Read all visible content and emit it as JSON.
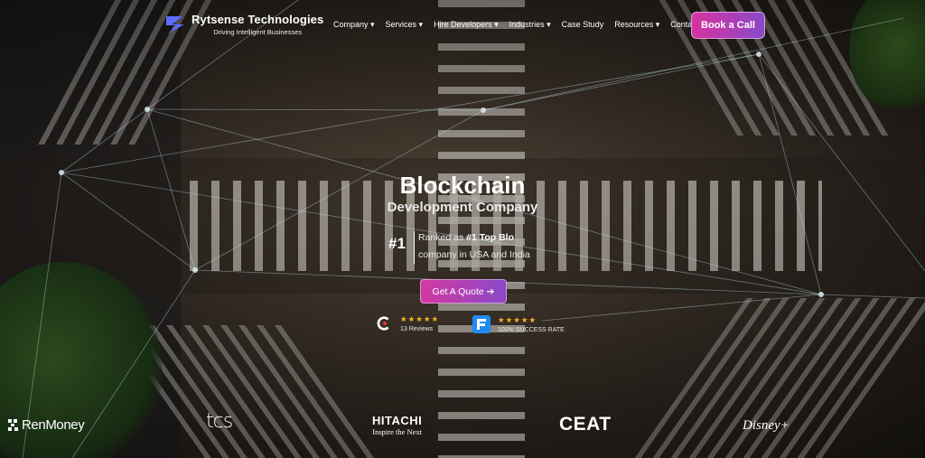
{
  "brand": {
    "name": "Rytsense Technologies",
    "tagline": "Driving Intelligent Businesses"
  },
  "nav": {
    "items": [
      {
        "label": "Company ▾"
      },
      {
        "label": "Services ▾"
      },
      {
        "label": "Hire Developers ▾"
      },
      {
        "label": "Industries ▾"
      },
      {
        "label": "Case Study"
      },
      {
        "label": "Resources ▾"
      },
      {
        "label": "Contact Us"
      }
    ],
    "cta": "Book a Call"
  },
  "hero": {
    "title": "Blockchain",
    "subtitle": "Development Company",
    "rank_number": "#1",
    "rank_prefix": "Ranked as ",
    "rank_bold": "#1 Top Blo",
    "rank_line2": "company in USA and India",
    "cta": "Get A Quote ➔"
  },
  "reviews": [
    {
      "icon": "clutch-icon",
      "stars": "★★★★★",
      "label": "13 Reviews"
    },
    {
      "icon": "goodfirms-icon",
      "stars": "★★★★★",
      "label": "100% SUCCESS RATE"
    }
  ],
  "clients": {
    "renmoney": "RenMoney",
    "tcs": "tcs",
    "hitachi": "HITACHI",
    "hitachi_tag": "Inspire the Next",
    "ceat": "CEAT",
    "disney": "Disney+"
  },
  "colors": {
    "cta_start": "#d6339f",
    "cta_end": "#8a49c9",
    "star": "#f5b818"
  }
}
